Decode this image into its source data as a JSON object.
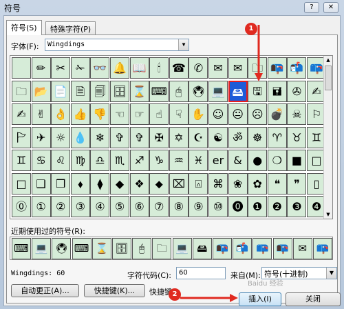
{
  "window": {
    "title": "符号",
    "help": "?",
    "close": "✕"
  },
  "tabs": [
    {
      "label": "符号(S)"
    },
    {
      "label": "特殊字符(P)"
    }
  ],
  "font": {
    "label": "字体(F):",
    "value": "Wingdings"
  },
  "grid": {
    "rows": [
      [
        "",
        "✏",
        "✂",
        "✁",
        "👓",
        "🔔",
        "📖",
        "🕯",
        "☎",
        "✆",
        "✉",
        "✉",
        "🗀",
        "📭",
        "📬",
        "📪"
      ],
      [
        "🗀",
        "📂",
        "📄",
        "🗎",
        "🗐",
        "🗄",
        "⌛",
        "⌨",
        "🖰",
        "🖲",
        "💻",
        "🖴",
        "🖫",
        "🖬",
        "✇",
        "✍"
      ],
      [
        "✍",
        "✌",
        "👌",
        "👍",
        "👎",
        "☜",
        "☞",
        "☝",
        "☟",
        "✋",
        "☺",
        "😐",
        "☹",
        "💣",
        "☠",
        "⚐"
      ],
      [
        "🏱",
        "✈",
        "☼",
        "💧",
        "❄",
        "✞",
        "✞",
        "✠",
        "✡",
        "☪",
        "☯",
        "ॐ",
        "☸",
        "♈",
        "♉",
        "♊"
      ],
      [
        "♊",
        "♋",
        "♌",
        "♍",
        "♎",
        "♏",
        "♐",
        "♑",
        "♒",
        "♓",
        "er",
        "&",
        "●",
        "❍",
        "■",
        "□"
      ],
      [
        "□",
        "❑",
        "❒",
        "⬧",
        "⧫",
        "◆",
        "❖",
        "⬥",
        "⌧",
        "⍓",
        "⌘",
        "❀",
        "✿",
        "❝",
        "❞",
        "▯"
      ],
      [
        "⓪",
        "①",
        "②",
        "③",
        "④",
        "⑤",
        "⑥",
        "⑦",
        "⑧",
        "⑨",
        "⑩",
        "⓿",
        "❶",
        "❷",
        "❸",
        "❹"
      ]
    ],
    "selected": "🖫"
  },
  "recent": {
    "label": "近期使用过的符号(R):",
    "items": [
      "⌨",
      "💻",
      "🖲",
      "⌨",
      "⌛",
      "🗄",
      "🖰",
      "🗀",
      "💻",
      "🖴",
      "📭",
      "📬",
      "📪",
      "📭",
      "✉",
      "📪"
    ]
  },
  "status": {
    "font_code": "Wingdings: 60",
    "code_label": "字符代码(C):",
    "code_value": "60",
    "from_label": "来自(M):",
    "from_value": "符号(十进制)"
  },
  "buttons": {
    "autocorrect": "自动更正(A)...",
    "shortcut": "快捷键(K)...",
    "shortcut_label": "快捷键:",
    "insert": "插入(I)",
    "cancel": "关闭"
  },
  "markers": {
    "one": "1",
    "two": "2"
  },
  "watermark": "Baidu 经验"
}
